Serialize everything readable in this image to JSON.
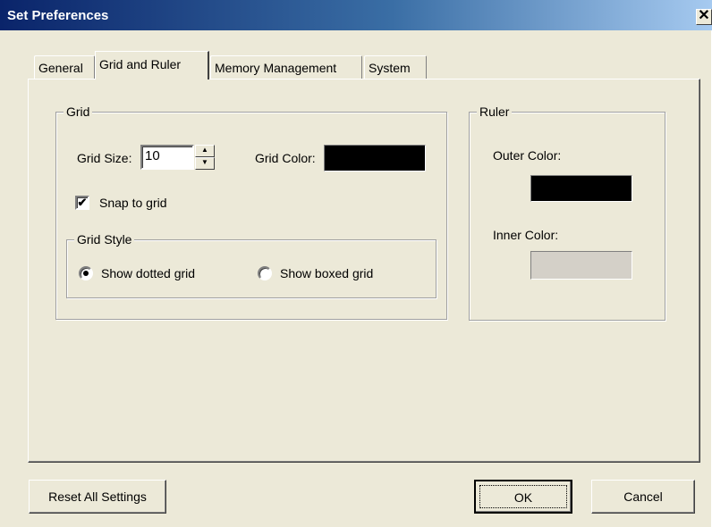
{
  "window": {
    "title": "Set Preferences",
    "close_glyph": "✕"
  },
  "tabs": [
    {
      "label": "General"
    },
    {
      "label": "Grid and Ruler"
    },
    {
      "label": "Memory Management"
    },
    {
      "label": "System"
    }
  ],
  "grid": {
    "legend": "Grid",
    "size_label": "Grid Size:",
    "size_value": "10",
    "color_label": "Grid Color:",
    "color": "#000000",
    "snap_label": "Snap to grid",
    "snap_checked": true,
    "style_legend": "Grid Style",
    "style_options": [
      {
        "label": "Show dotted grid",
        "selected": true
      },
      {
        "label": "Show boxed grid",
        "selected": false
      }
    ]
  },
  "ruler": {
    "legend": "Ruler",
    "outer_label": "Outer Color:",
    "outer_color": "#000000",
    "inner_label": "Inner Color:",
    "inner_color": "#d4d0c8"
  },
  "buttons": {
    "reset": "Reset All Settings",
    "ok": "OK",
    "cancel": "Cancel"
  },
  "icons": {
    "check": "✔",
    "spin_up": "▲",
    "spin_down": "▼"
  }
}
